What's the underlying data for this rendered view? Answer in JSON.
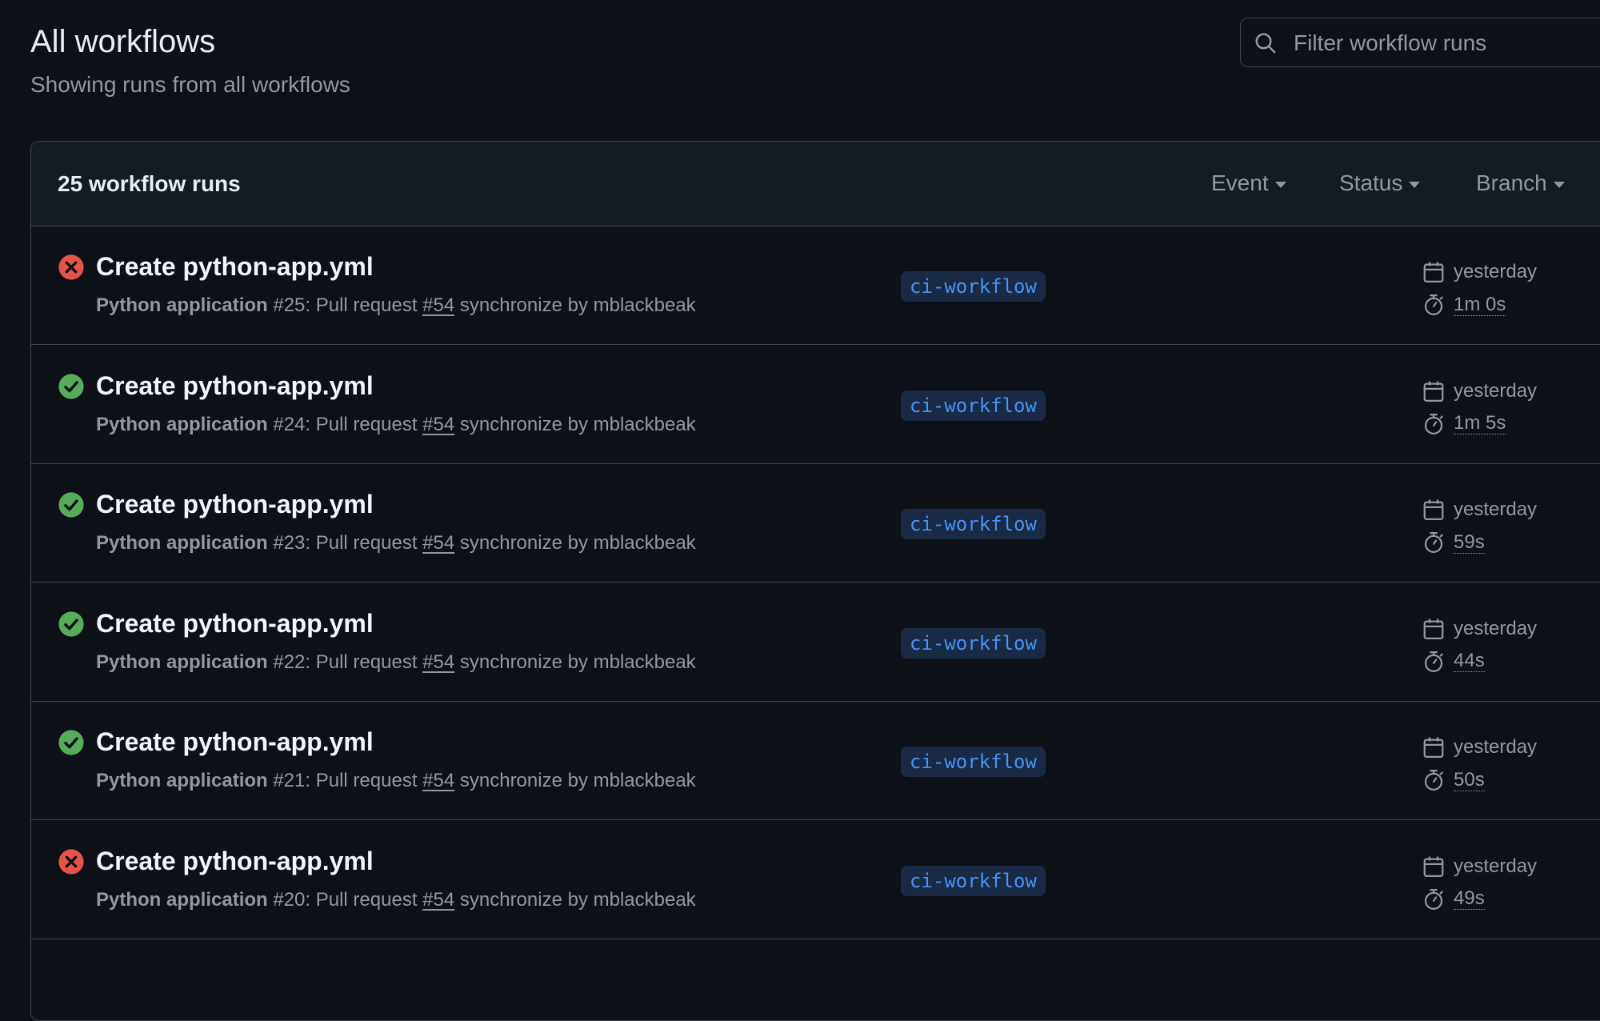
{
  "header": {
    "title": "All workflows",
    "subtitle": "Showing runs from all workflows"
  },
  "search": {
    "placeholder": "Filter workflow runs"
  },
  "list": {
    "count_label": "25 workflow runs",
    "filters": {
      "event": "Event",
      "status": "Status",
      "branch": "Branch"
    }
  },
  "colors": {
    "failure": "#e5534b",
    "success": "#57ab5a",
    "accent": "#4493f8"
  },
  "runs": [
    {
      "status": "failure",
      "status_icon": "x-circle-icon",
      "title": "Create python-app.yml",
      "workflow": "Python application",
      "number": "#25",
      "meta_mid": ": Pull request ",
      "pr": "#54",
      "meta_end": " synchronize by mblackbeak",
      "branch": "ci-workflow",
      "date": "yesterday",
      "duration": "1m 0s"
    },
    {
      "status": "success",
      "status_icon": "check-circle-icon",
      "title": "Create python-app.yml",
      "workflow": "Python application",
      "number": "#24",
      "meta_mid": ": Pull request ",
      "pr": "#54",
      "meta_end": " synchronize by mblackbeak",
      "branch": "ci-workflow",
      "date": "yesterday",
      "duration": "1m 5s"
    },
    {
      "status": "success",
      "status_icon": "check-circle-icon",
      "title": "Create python-app.yml",
      "workflow": "Python application",
      "number": "#23",
      "meta_mid": ": Pull request ",
      "pr": "#54",
      "meta_end": " synchronize by mblackbeak",
      "branch": "ci-workflow",
      "date": "yesterday",
      "duration": "59s"
    },
    {
      "status": "success",
      "status_icon": "check-circle-icon",
      "title": "Create python-app.yml",
      "workflow": "Python application",
      "number": "#22",
      "meta_mid": ": Pull request ",
      "pr": "#54",
      "meta_end": " synchronize by mblackbeak",
      "branch": "ci-workflow",
      "date": "yesterday",
      "duration": "44s"
    },
    {
      "status": "success",
      "status_icon": "check-circle-icon",
      "title": "Create python-app.yml",
      "workflow": "Python application",
      "number": "#21",
      "meta_mid": ": Pull request ",
      "pr": "#54",
      "meta_end": " synchronize by mblackbeak",
      "branch": "ci-workflow",
      "date": "yesterday",
      "duration": "50s"
    },
    {
      "status": "failure",
      "status_icon": "x-circle-icon",
      "title": "Create python-app.yml",
      "workflow": "Python application",
      "number": "#20",
      "meta_mid": ": Pull request ",
      "pr": "#54",
      "meta_end": " synchronize by mblackbeak",
      "branch": "ci-workflow",
      "date": "yesterday",
      "duration": "49s"
    }
  ]
}
